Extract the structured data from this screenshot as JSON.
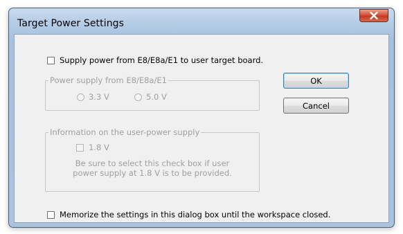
{
  "window": {
    "title": "Target Power Settings",
    "close_icon": "close-icon"
  },
  "supply_power": {
    "label": "Supply power from E8/E8a/E1 to user target board.",
    "checked": false
  },
  "power_supply_group": {
    "caption": "Power supply from E8/E8a/E1",
    "options": [
      "3.3 V",
      "5.0 V"
    ],
    "enabled": false
  },
  "info_group": {
    "caption": "Information on the user-power supply",
    "checkbox_label": "1.8 V",
    "note_line1": "Be sure to select this check box if user",
    "note_line2": "power supply at 1.8 V is to be provided."
  },
  "buttons": {
    "ok": "OK",
    "cancel": "Cancel"
  },
  "memorize": {
    "label": "Memorize the settings in this dialog box until the workspace closed.",
    "checked": false
  },
  "colors": {
    "frame": "#b6cde6",
    "client": "#f0f0f0",
    "close_button": "#c43a22",
    "disabled_text": "#a0a0a0"
  }
}
